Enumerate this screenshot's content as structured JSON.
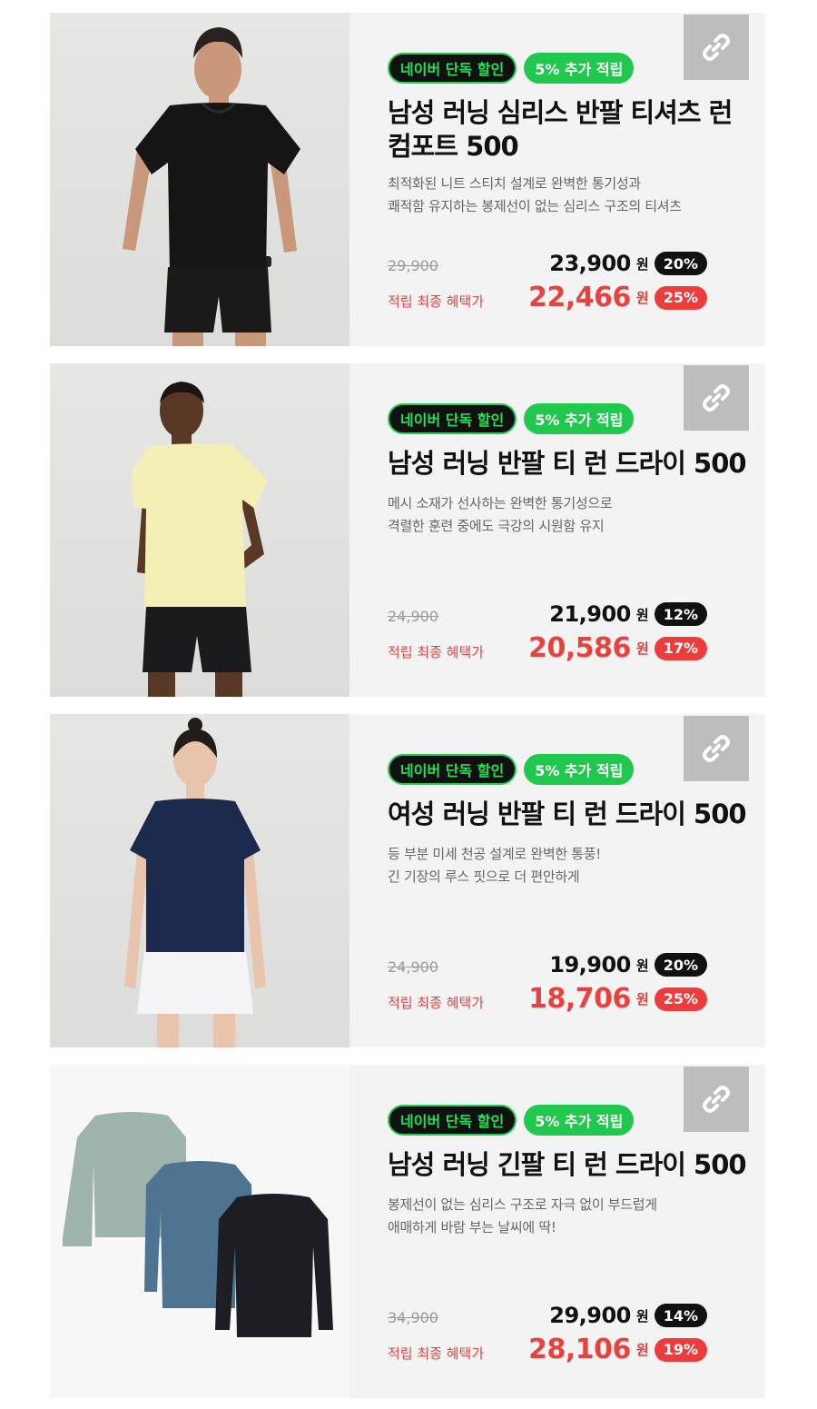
{
  "products": [
    {
      "badge_naver": "네이버 단독 할인",
      "badge_points": "5% 추가 적립",
      "title": "남성 러닝 심리스 반팔 티셔츠 런 컴포트 500",
      "desc_1": "최적화된 니트 스티치 설계로 완벽한 통기성과",
      "desc_2": "쾌적함 유지하는 봉제선이 없는 심리스 구조의 티셔츠",
      "original_price": "29,900",
      "sale_price": "23,900",
      "sale_unit": "원",
      "sale_pct": "20%",
      "final_label": "적립 최종 혜택가",
      "final_price": "22,466",
      "final_unit": "원",
      "final_pct": "25%",
      "shirt_color": "#151515",
      "bottom_color": "#1a1a1a",
      "skin_color": "#c9987a"
    },
    {
      "badge_naver": "네이버 단독 할인",
      "badge_points": "5% 추가 적립",
      "title": "남성 러닝 반팔 티 런 드라이 500",
      "desc_1": "메시 소재가 선사하는 완벽한 통기성으로",
      "desc_2": "격렬한 훈련 중에도 극강의 시원함 유지",
      "original_price": "24,900",
      "sale_price": "21,900",
      "sale_unit": "원",
      "sale_pct": "12%",
      "final_label": "적립 최종 혜택가",
      "final_price": "20,586",
      "final_unit": "원",
      "final_pct": "17%",
      "shirt_color": "#f4efb4",
      "bottom_color": "#1b1b1f",
      "skin_color": "#5a3826"
    },
    {
      "badge_naver": "네이버 단독 할인",
      "badge_points": "5% 추가 적립",
      "title": "여성 러닝 반팔 티 런 드라이 500",
      "desc_1": "등 부분 미세 천공 설계로 완벽한 통풍!",
      "desc_2": "긴 기장의 루스 핏으로 더 편안하게",
      "original_price": "24,900",
      "sale_price": "19,900",
      "sale_unit": "원",
      "sale_pct": "20%",
      "final_label": "적립 최종 혜택가",
      "final_price": "18,706",
      "final_unit": "원",
      "final_pct": "25%",
      "shirt_color": "#1b2a4d",
      "bottom_color": "#f4f4f6",
      "skin_color": "#e8c4ac"
    },
    {
      "badge_naver": "네이버 단독 할인",
      "badge_points": "5% 추가 적립",
      "title": "남성 러닝 긴팔 티 런 드라이 500",
      "desc_1": "봉제선이 없는 심리스 구조로 자극 없이 부드럽게",
      "desc_2": "애매하게 바람 부는 날씨에 딱!",
      "original_price": "34,900",
      "sale_price": "29,900",
      "sale_unit": "원",
      "sale_pct": "14%",
      "final_label": "적립 최종 혜택가",
      "final_price": "28,106",
      "final_unit": "원",
      "final_pct": "19%",
      "shirt_colors": [
        "#9fb3ad",
        "#4f7491",
        "#1c1e24"
      ]
    }
  ],
  "icons": {
    "link_button": "link-icon"
  }
}
